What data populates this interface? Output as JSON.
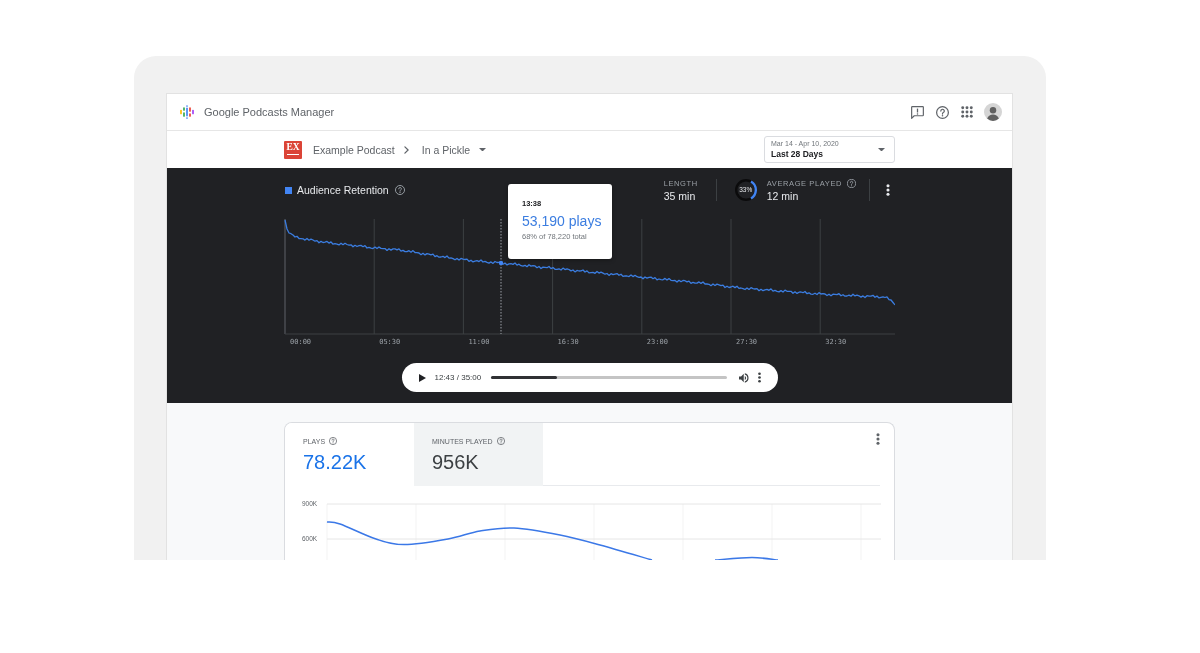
{
  "app_bar": {
    "title": "Google Podcasts Manager"
  },
  "toolbar": {
    "cover_text": "EX",
    "podcast": "Example Podcast",
    "episode": "In a Pickle",
    "date_range": {
      "dates": "Mar 14 - Apr 10, 2020",
      "preset": "Last 28 Days"
    }
  },
  "retention": {
    "title": "Audience Retention",
    "stats": [
      {
        "kind": "plain",
        "label": "LENGTH",
        "value": "35 min"
      },
      {
        "kind": "ring",
        "label": "AVERAGE PLAYED",
        "value": "12 min",
        "ring_text": "33%",
        "level": 0.33
      }
    ],
    "x_axis_labels": [
      "00:00",
      "05:30",
      "11:00",
      "16:30",
      "23:00",
      "27:30",
      "32:30"
    ],
    "tooltip": {
      "time": "13:38",
      "plays": "53,190 plays",
      "detail": "68% of 78,220 total"
    },
    "player": {
      "time": "12:43 / 35:00",
      "level": 0.28
    }
  },
  "metrics": {
    "tabs": [
      {
        "label": "PLAYS",
        "value": "78.22K",
        "selected": true
      },
      {
        "label": "MINUTES PLAYED",
        "value": "956K",
        "selected": false
      }
    ],
    "y_axis_labels": [
      "900K",
      "600K"
    ]
  }
}
